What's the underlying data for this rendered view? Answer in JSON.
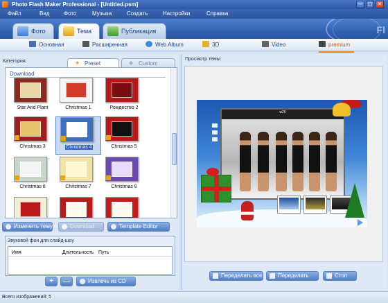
{
  "window": {
    "title": "Photo Flash Maker Professional - [Untitled.psm]",
    "buttons": {
      "minimize": "—",
      "maximize": "▢",
      "close": "✕"
    }
  },
  "menu": {
    "items": [
      "Файл",
      "Вид",
      "Фото",
      "Музыка",
      "Создать",
      "Настройки",
      "Справка"
    ]
  },
  "main_tabs": [
    {
      "label": "Фото",
      "icon": "photo-icon"
    },
    {
      "label": "Тема",
      "icon": "theme-icon",
      "active": true
    },
    {
      "label": "Публикация",
      "icon": "publish-icon"
    }
  ],
  "sub_tabs": [
    {
      "label": "Основная",
      "icon": "basic-icon"
    },
    {
      "label": "Расширенная",
      "icon": "advanced-icon"
    },
    {
      "label": "Web Album",
      "icon": "web-album-icon"
    },
    {
      "label": "3D",
      "icon": "3d-icon"
    },
    {
      "label": "Video",
      "icon": "video-icon"
    },
    {
      "label": "premium",
      "icon": "premium-icon",
      "active": true
    }
  ],
  "left": {
    "category_label": "Категория:",
    "tabs": [
      {
        "label": "Preset",
        "icon": "star-icon"
      },
      {
        "label": "Custom",
        "icon": "custom-icon"
      }
    ],
    "group_header": "Download",
    "themes": [
      {
        "name": "Star And Plant",
        "color": "#8b2a1e"
      },
      {
        "name": "Christmas 1",
        "color": "#f4f4f4"
      },
      {
        "name": "Рождество 2",
        "color": "#b51a1a"
      },
      {
        "name": "Christmas 3",
        "color": "#9e1f1f"
      },
      {
        "name": "Christmas 4",
        "color": "#3c6fbf"
      },
      {
        "name": "Christmas 5",
        "color": "#111111"
      },
      {
        "name": "Christmas 6",
        "color": "#c8d6c9"
      },
      {
        "name": "Christmas 7",
        "color": "#f1e3a4"
      },
      {
        "name": "Christmas 8",
        "color": "#6b4ab0"
      },
      {
        "name": "",
        "color": "#f3f0d8"
      },
      {
        "name": "",
        "color": "#b81a1a"
      },
      {
        "name": "",
        "color": "#c21c1c"
      }
    ],
    "selected_theme": "Christmas 4",
    "buttons": {
      "change_theme": "Изменить тему",
      "download": "Download",
      "template_editor": "Template Editor"
    },
    "audio": {
      "label": "Звуковой фон для слайд-шоу",
      "columns": [
        "Имя",
        "Длительность",
        "Путь"
      ],
      "add": "+",
      "remove": "—",
      "extract": "Извлечь из CD"
    }
  },
  "right": {
    "preview_label": "Просмотр темы:",
    "player_title": "w26",
    "buttons": {
      "redo_all": "Переделать все",
      "redo": "Переделать",
      "stop": "Стоп"
    }
  },
  "status": {
    "text": "Всего изображений: 5"
  },
  "colors": {
    "accent": "#2f5fb0",
    "premium": "#d65e00",
    "selected": "#2f62c8"
  }
}
